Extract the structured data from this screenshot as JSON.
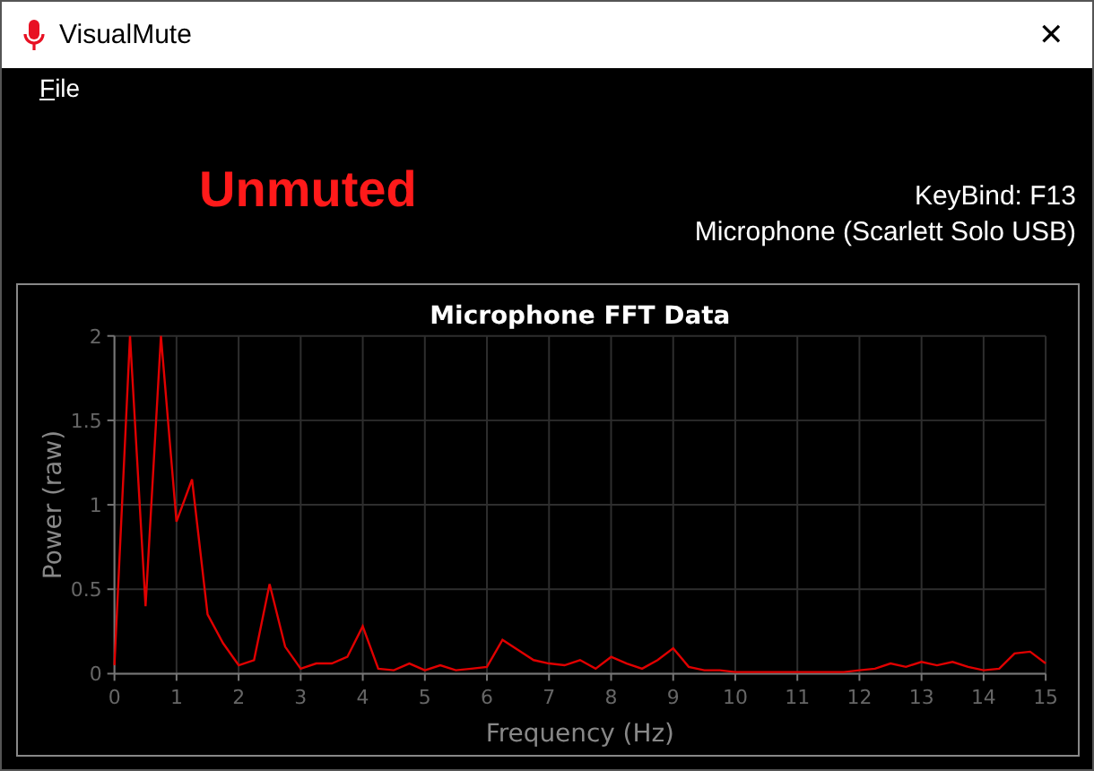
{
  "window": {
    "title": "VisualMute",
    "close": "✕"
  },
  "menu": [
    {
      "label": "File"
    }
  ],
  "status": {
    "label": "Unmuted",
    "muted": false
  },
  "info": {
    "keybind": "KeyBind: F13",
    "device": "Microphone (Scarlett Solo USB)"
  },
  "chart": {
    "chart_data": {
      "type": "line",
      "title": "Microphone FFT Data",
      "xlabel": "Frequency (Hz)",
      "ylabel": "Power (raw)",
      "xlim": [
        0,
        15
      ],
      "ylim": [
        0,
        2
      ],
      "xticks": [
        0,
        1,
        2,
        3,
        4,
        5,
        6,
        7,
        8,
        9,
        10,
        11,
        12,
        13,
        14,
        15
      ],
      "yticks": [
        0,
        {
          "value": 0.5,
          "label": "0.5"
        },
        1,
        {
          "value": 1.5,
          "label": "1.5"
        },
        2
      ],
      "x": [
        0,
        0.25,
        0.5,
        0.75,
        1,
        1.25,
        1.5,
        1.75,
        2,
        2.25,
        2.5,
        2.75,
        3,
        3.25,
        3.5,
        3.75,
        4,
        4.25,
        4.5,
        4.75,
        5,
        5.25,
        5.5,
        5.75,
        6,
        6.25,
        6.5,
        6.75,
        7,
        7.25,
        7.5,
        7.75,
        8,
        8.25,
        8.5,
        8.75,
        9,
        9.25,
        9.5,
        9.75,
        10,
        10.25,
        10.5,
        10.75,
        11,
        11.25,
        11.5,
        11.75,
        12,
        12.25,
        12.5,
        12.75,
        13,
        13.25,
        13.5,
        13.75,
        14,
        14.25,
        14.5,
        14.75,
        15
      ],
      "grid": true,
      "series": [
        {
          "color": "#e00000",
          "values": [
            0.05,
            2,
            0.4,
            2,
            0.9,
            1.15,
            0.35,
            0.18,
            0.05,
            0.08,
            0.53,
            0.16,
            0.03,
            0.06,
            0.06,
            0.1,
            0.28,
            0.03,
            0.02,
            0.06,
            0.02,
            0.05,
            0.02,
            0.03,
            0.04,
            0.2,
            0.14,
            0.08,
            0.06,
            0.05,
            0.08,
            0.03,
            0.1,
            0.06,
            0.03,
            0.08,
            0.15,
            0.04,
            0.02,
            0.02,
            0.01,
            0.01,
            0.01,
            0.01,
            0.01,
            0.01,
            0.01,
            0.01,
            0.02,
            0.03,
            0.06,
            0.04,
            0.07,
            0.05,
            0.07,
            0.04,
            0.02,
            0.03,
            0.12,
            0.13,
            0.06
          ]
        }
      ]
    }
  }
}
